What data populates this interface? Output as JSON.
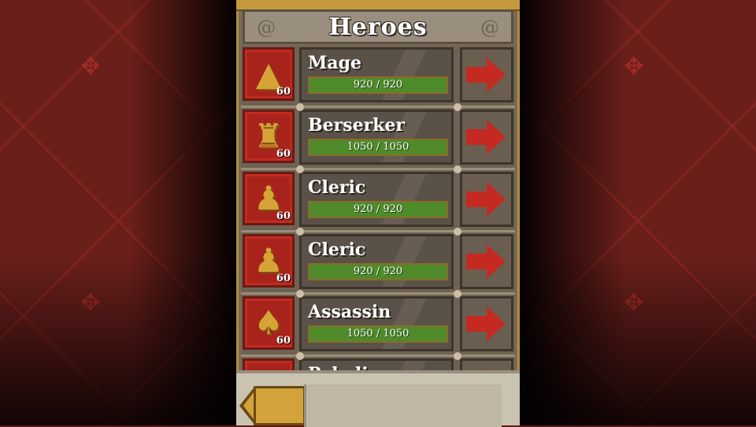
{
  "screen": {
    "title": "Heroes",
    "colors": {
      "background": "#6a1f1b",
      "panel": "#7a6a58",
      "hp_bar": "#4f8a2b",
      "portrait_frame": "#c22b20",
      "arrow": "#c52a22",
      "gold": "#d2a33a"
    }
  },
  "heroes": [
    {
      "name": "Mage",
      "level": "60",
      "hp_text": "920 / 920",
      "hp_fraction": 1.0,
      "icon": "wizard-hat-icon"
    },
    {
      "name": "Berserker",
      "level": "60",
      "hp_text": "1050 / 1050",
      "hp_fraction": 1.0,
      "icon": "horned-helmet-icon"
    },
    {
      "name": "Cleric",
      "level": "60",
      "hp_text": "920 / 920",
      "hp_fraction": 1.0,
      "icon": "hooded-figure-icon"
    },
    {
      "name": "Cleric",
      "level": "60",
      "hp_text": "920 / 920",
      "hp_fraction": 1.0,
      "icon": "hooded-figure-icon"
    },
    {
      "name": "Assassin",
      "level": "60",
      "hp_text": "1050 / 1050",
      "hp_fraction": 1.0,
      "icon": "hood-icon"
    },
    {
      "name": "Paladin",
      "level": "",
      "hp_text": "",
      "hp_fraction": 1.0,
      "icon": "helmet-icon"
    }
  ],
  "footer": {
    "back_icon": "back-arrow-icon"
  }
}
